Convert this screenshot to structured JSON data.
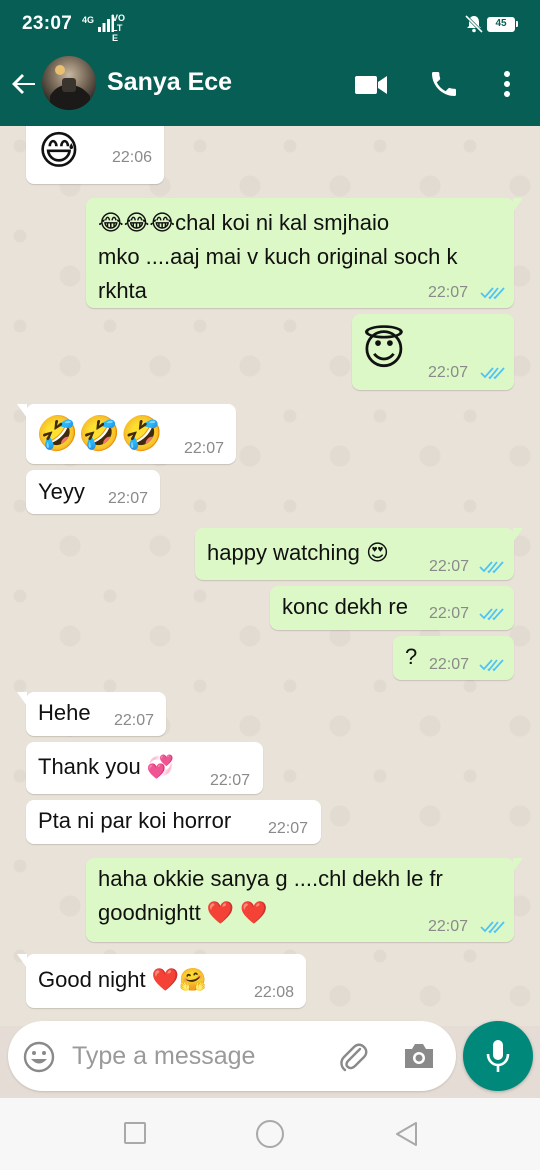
{
  "status_bar": {
    "time": "23:07",
    "network": "4G",
    "volte": "VO LTE",
    "battery": "45"
  },
  "header": {
    "contact_name": "Sanya Ece"
  },
  "messages": [
    {
      "dir": "in",
      "text": "😅",
      "time": "22:06"
    },
    {
      "dir": "out",
      "lines": [
        "😂😂😂chal koi ni kal smjhaio",
        "mko ....aaj mai v kuch original soch k",
        "rkhta"
      ],
      "time": "22:07",
      "ticks": "read"
    },
    {
      "dir": "out",
      "text": "😇",
      "time": "22:07",
      "ticks": "read"
    },
    {
      "dir": "in",
      "text": "🤣🤣🤣",
      "time": "22:07"
    },
    {
      "dir": "in",
      "text": "Yeyy",
      "time": "22:07"
    },
    {
      "dir": "out",
      "text": "happy watching 😍",
      "time": "22:07",
      "ticks": "read"
    },
    {
      "dir": "out",
      "text": "konc dekh re",
      "time": "22:07",
      "ticks": "read"
    },
    {
      "dir": "out",
      "text": "?",
      "time": "22:07",
      "ticks": "read"
    },
    {
      "dir": "in",
      "text": "Hehe",
      "time": "22:07"
    },
    {
      "dir": "in",
      "text": "Thank you 💞",
      "time": "22:07"
    },
    {
      "dir": "in",
      "text": "Pta ni par koi horror",
      "time": "22:07"
    },
    {
      "dir": "out",
      "lines": [
        "haha okkie sanya g ....chl dekh le fr",
        "goodnightt ❤️ ❤️"
      ],
      "time": "22:07",
      "ticks": "read"
    },
    {
      "dir": "in",
      "text": "Good night ❤️🤗",
      "time": "22:08"
    }
  ],
  "composer": {
    "placeholder": "Type a message"
  },
  "icons": {
    "back": "arrow-left-icon",
    "video": "video-camera-icon",
    "call": "phone-icon",
    "more": "more-vert-icon",
    "emoji": "emoji-icon",
    "attach": "paperclip-icon",
    "camera": "camera-icon",
    "mic": "microphone-icon"
  },
  "colors": {
    "header": "#075e54",
    "outgoing_bubble": "#dcf8c6",
    "incoming_bubble": "#ffffff",
    "read_ticks": "#4fc3f7",
    "mic_button": "#00897b"
  }
}
